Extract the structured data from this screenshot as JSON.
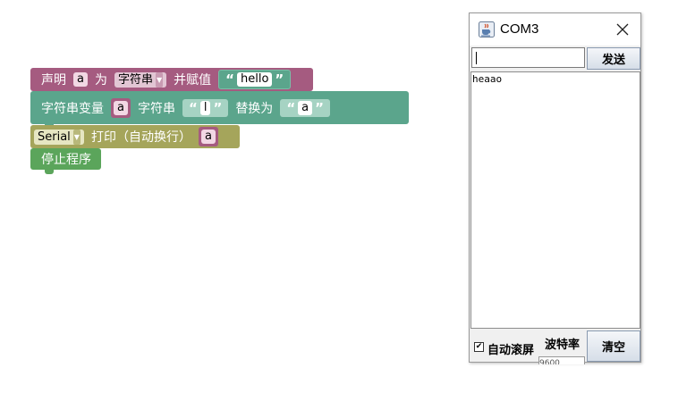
{
  "blocks": {
    "declare": {
      "label": "声明",
      "var": "a",
      "for_label": "为",
      "type_value": "字符串",
      "assign_label": "并赋值",
      "value": "hello"
    },
    "replace": {
      "label": "字符串变量",
      "var": "a",
      "str_label": "字符串",
      "find": "l",
      "replace_label": "替换为",
      "replace_with": "a"
    },
    "print": {
      "port": "Serial",
      "label": "打印（自动换行）",
      "var": "a"
    },
    "stop": {
      "label": "停止程序"
    },
    "quote_open": "“",
    "quote_close": "”",
    "dropdown_arrow": "▼"
  },
  "window": {
    "title": "COM3",
    "input_value": "",
    "send_label": "发送",
    "output": "heaao",
    "autoscroll_label": "自动滚屏",
    "autoscroll_checked": true,
    "checkmark": "✔",
    "baud_label": "波特率",
    "baud_value": "9600",
    "clear_label": "清空",
    "icons": {
      "app": "java-cup-icon",
      "close": "close-icon"
    },
    "colors": {
      "declare": "#a55b80",
      "text": "#5ba58c",
      "serial": "#a5a55b",
      "control": "#5ba55b"
    }
  }
}
